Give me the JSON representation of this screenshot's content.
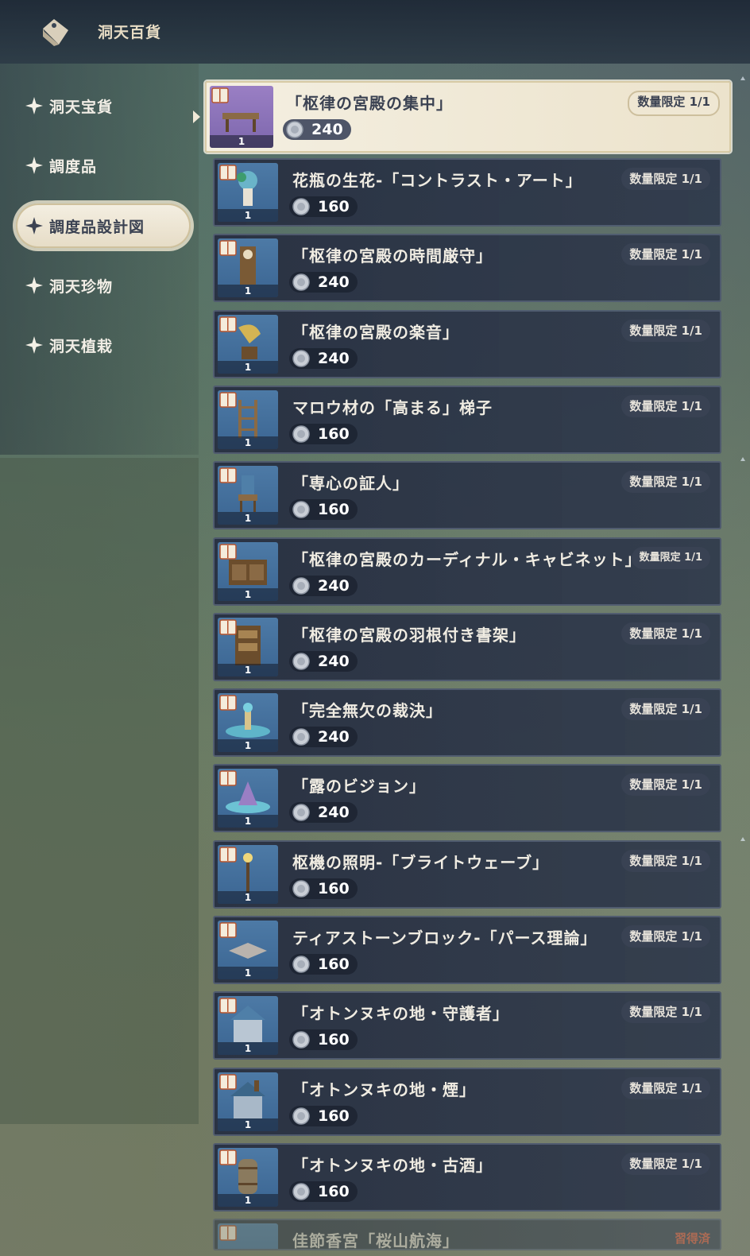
{
  "header": {
    "title": "洞天百貨",
    "icon": "tag-icon"
  },
  "sidebar": {
    "items": [
      {
        "label": "洞天宝貨",
        "selected": false
      },
      {
        "label": "調度品",
        "selected": false
      },
      {
        "label": "調度品設計図",
        "selected": true
      },
      {
        "label": "洞天珍物",
        "selected": false
      },
      {
        "label": "洞天植栽",
        "selected": false
      }
    ]
  },
  "items": [
    {
      "name": "「枢律の宮殿の集中」",
      "price": "240",
      "limit": "数量限定 1/1",
      "count": "1",
      "art": "table"
    },
    {
      "name": "花瓶の生花-「コントラスト・アート」",
      "price": "160",
      "limit": "数量限定 1/1",
      "count": "1",
      "art": "vase"
    },
    {
      "name": "「枢律の宮殿の時間厳守」",
      "price": "240",
      "limit": "数量限定 1/1",
      "count": "1",
      "art": "clock"
    },
    {
      "name": "「枢律の宮殿の楽音」",
      "price": "240",
      "limit": "数量限定 1/1",
      "count": "1",
      "art": "gramophone"
    },
    {
      "name": "マロウ材の「高まる」梯子",
      "price": "160",
      "limit": "数量限定 1/1",
      "count": "1",
      "art": "ladder"
    },
    {
      "name": "「専心の証人」",
      "price": "160",
      "limit": "数量限定 1/1",
      "count": "1",
      "art": "chair"
    },
    {
      "name": "「枢律の宮殿のカーディナル・キャビネット」",
      "price": "240",
      "limit": "数量限定 1/1",
      "count": "1",
      "art": "cabinet"
    },
    {
      "name": "「枢律の宮殿の羽根付き書架」",
      "price": "240",
      "limit": "数量限定 1/1",
      "count": "1",
      "art": "bookshelf"
    },
    {
      "name": "「完全無欠の裁決」",
      "price": "240",
      "limit": "数量限定 1/1",
      "count": "1",
      "art": "fountain"
    },
    {
      "name": "「露のビジョン」",
      "price": "240",
      "limit": "数量限定 1/1",
      "count": "1",
      "art": "fountain2"
    },
    {
      "name": "枢機の照明-「ブライトウェーブ」",
      "price": "160",
      "limit": "数量限定 1/1",
      "count": "1",
      "art": "lamp"
    },
    {
      "name": "ティアストーンブロック-「パース理論」",
      "price": "160",
      "limit": "数量限定 1/1",
      "count": "1",
      "art": "tile"
    },
    {
      "name": "「オトンヌキの地・守護者」",
      "price": "160",
      "limit": "数量限定 1/1",
      "count": "1",
      "art": "house"
    },
    {
      "name": "「オトンヌキの地・煙」",
      "price": "160",
      "limit": "数量限定 1/1",
      "count": "1",
      "art": "house2"
    },
    {
      "name": "「オトンヌキの地・古酒」",
      "price": "160",
      "limit": "数量限定 1/1",
      "count": "1",
      "art": "barrel"
    },
    {
      "name": "佳節香宮「桜山航海」",
      "owned": "習得済"
    }
  ],
  "colors": {
    "accent": "#e7dcc4",
    "panel": "#2f3a4e",
    "selected_bg": "#f1ebdb",
    "owned": "#d4583d"
  }
}
